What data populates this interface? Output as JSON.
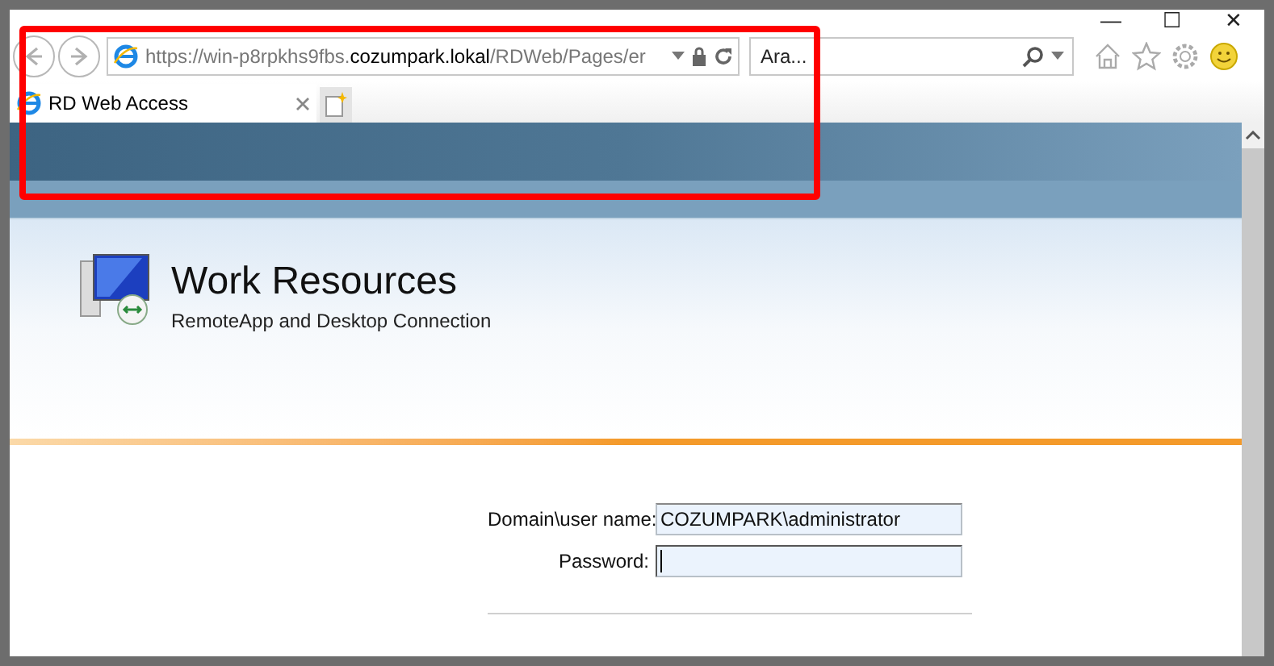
{
  "window": {
    "controls": [
      "—",
      "☐",
      "✕"
    ]
  },
  "address_bar": {
    "url": "https://win-p8rpkhs9fbs.**cozumpark.lokal**/RDWeb/Pages/er"
  },
  "search": {
    "placeholder": "Ara..."
  },
  "tabs": [
    {
      "label": "RD Web Access",
      "selected": true
    }
  ],
  "header": {
    "title": "Work Resources",
    "subtitle": "RemoteApp and Desktop Connection"
  },
  "form": {
    "fields": [
      {
        "label": "Domain\\user name:",
        "value": "COZUMPARK\\administrator",
        "focused": false
      },
      {
        "label": "Password:",
        "focused": true
      }
    ]
  }
}
